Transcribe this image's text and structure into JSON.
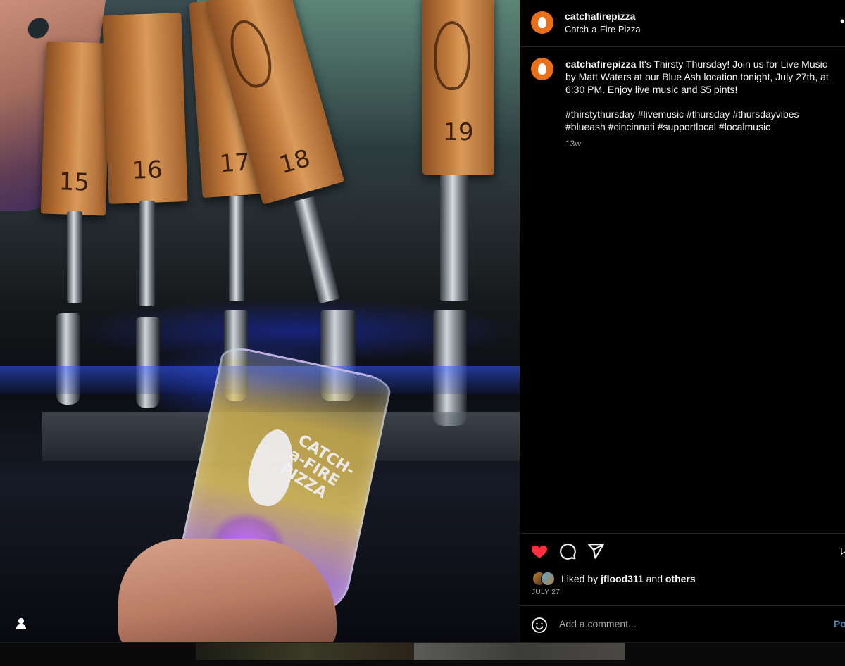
{
  "photo": {
    "tap_numbers": [
      "15",
      "16",
      "17",
      "18",
      "19"
    ],
    "glass_logo_text": "CATCH-a-FIRE PIZZA",
    "user_tag_icon": "person-icon"
  },
  "post": {
    "username": "catchafirepizza",
    "display_name": "Catch-a-Fire Pizza",
    "more_icon": "more-options-icon",
    "caption_username": "catchafirepizza",
    "caption_text": " It's Thirsty Thursday! Join us for Live Music by Matt Waters at our Blue Ash location tonight, July 27th, at 6:30 PM. Enjoy live music and $5 pints!",
    "hashtags": "#thirstythursday #livemusic #thursday #thursdayvibes #blueash #cincinnati #supportlocal #localmusic",
    "time_ago": "13w"
  },
  "actions": {
    "like_icon": "heart-filled-icon",
    "comment_icon": "comment-icon",
    "share_icon": "share-icon",
    "save_icon": "bookmark-icon"
  },
  "likes": {
    "prefix": "Liked by ",
    "user": "jflood311",
    "middle": " and ",
    "others": "others",
    "date": "JULY 27"
  },
  "comment_box": {
    "emoji_icon": "emoji-icon",
    "placeholder": "Add a comment...",
    "post_label": "Po"
  },
  "colors": {
    "brand_orange": "#e8701a",
    "like_red": "#ff3040",
    "post_blue": "#4a7fae",
    "background": "#000000"
  }
}
